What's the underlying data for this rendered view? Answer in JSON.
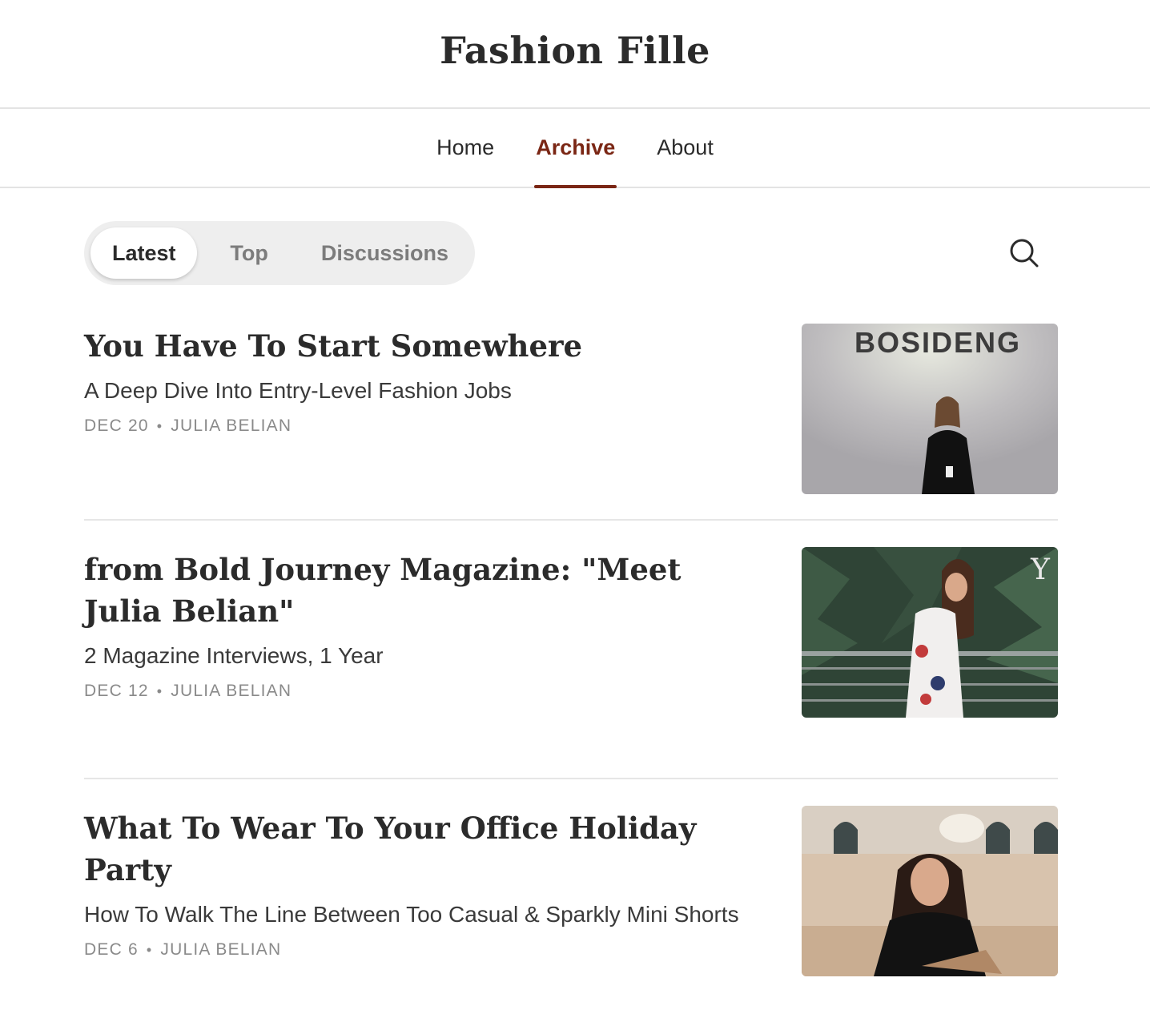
{
  "site": {
    "title": "Fashion Fille"
  },
  "nav": {
    "items": [
      {
        "label": "Home",
        "active": false
      },
      {
        "label": "Archive",
        "active": true
      },
      {
        "label": "About",
        "active": false
      }
    ]
  },
  "filters": {
    "latest": "Latest",
    "top": "Top",
    "discussions": "Discussions"
  },
  "colors": {
    "accent": "#7a2614",
    "muted": "#8a8a8a"
  },
  "posts": [
    {
      "title": "You Have To Start Somewhere",
      "subtitle": "A Deep Dive Into Entry-Level Fashion Jobs",
      "date": "DEC 20",
      "author": "JULIA BELIAN",
      "image_sign": "BOSIDENG"
    },
    {
      "title": "from Bold Journey Magazine: \"Meet Julia Belian\"",
      "subtitle": "2 Magazine Interviews, 1 Year",
      "date": "DEC 12",
      "author": "JULIA BELIAN"
    },
    {
      "title": "What To Wear To Your Office Holiday Party",
      "subtitle": "How To Walk The Line Between Too Casual & Sparkly Mini Shorts",
      "date": "DEC 6",
      "author": "JULIA BELIAN"
    }
  ]
}
